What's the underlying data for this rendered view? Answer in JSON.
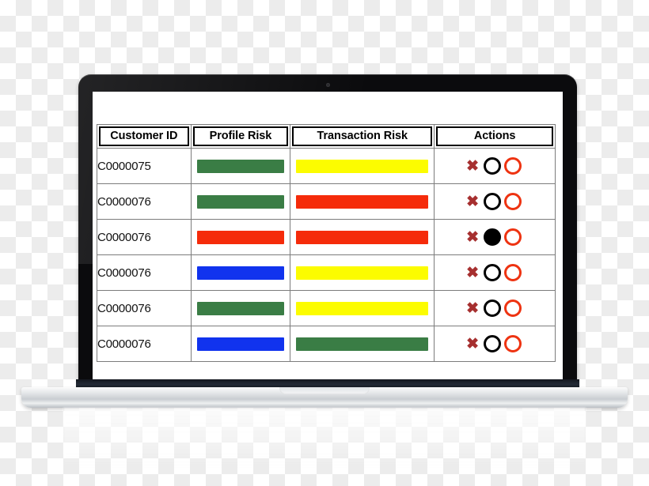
{
  "device": {
    "type": "laptop",
    "webcam": "webcam-dot"
  },
  "table": {
    "columns": [
      {
        "key": "customer_id",
        "label": "Customer ID"
      },
      {
        "key": "profile_risk",
        "label": "Profile Risk"
      },
      {
        "key": "transaction_risk",
        "label": "Transaction Risk"
      },
      {
        "key": "actions",
        "label": "Actions"
      }
    ],
    "rows": [
      {
        "customer_id": "C0000075",
        "profile_risk": "green",
        "transaction_risk": "yellow",
        "actions": {
          "delete": "✖",
          "toggle_black": "outline",
          "toggle_red": "outline"
        }
      },
      {
        "customer_id": "C0000076",
        "profile_risk": "green",
        "transaction_risk": "red",
        "actions": {
          "delete": "✖",
          "toggle_black": "outline",
          "toggle_red": "outline"
        }
      },
      {
        "customer_id": "C0000076",
        "profile_risk": "red",
        "transaction_risk": "red",
        "actions": {
          "delete": "✖",
          "toggle_black": "filled",
          "toggle_red": "outline"
        }
      },
      {
        "customer_id": "C0000076",
        "profile_risk": "blue",
        "transaction_risk": "yellow",
        "actions": {
          "delete": "✖",
          "toggle_black": "outline",
          "toggle_red": "outline"
        }
      },
      {
        "customer_id": "C0000076",
        "profile_risk": "green",
        "transaction_risk": "yellow",
        "actions": {
          "delete": "✖",
          "toggle_black": "outline",
          "toggle_red": "outline"
        }
      },
      {
        "customer_id": "C0000076",
        "profile_risk": "blue",
        "transaction_risk": "green",
        "actions": {
          "delete": "✖",
          "toggle_black": "outline",
          "toggle_red": "outline"
        }
      }
    ]
  },
  "colors": {
    "green": "#3a7d45",
    "red": "#f52b0a",
    "yellow": "#fcfc00",
    "blue": "#1133ee",
    "delete_x": "#a62f2f",
    "ring_black": "#000000",
    "ring_red": "#ee3311",
    "grid_line": "#7c7c7c",
    "header_border": "#000000",
    "screen_bg": "#ffffff",
    "bezel": "#0b0b0d",
    "chassis": "#c9cdd1"
  }
}
